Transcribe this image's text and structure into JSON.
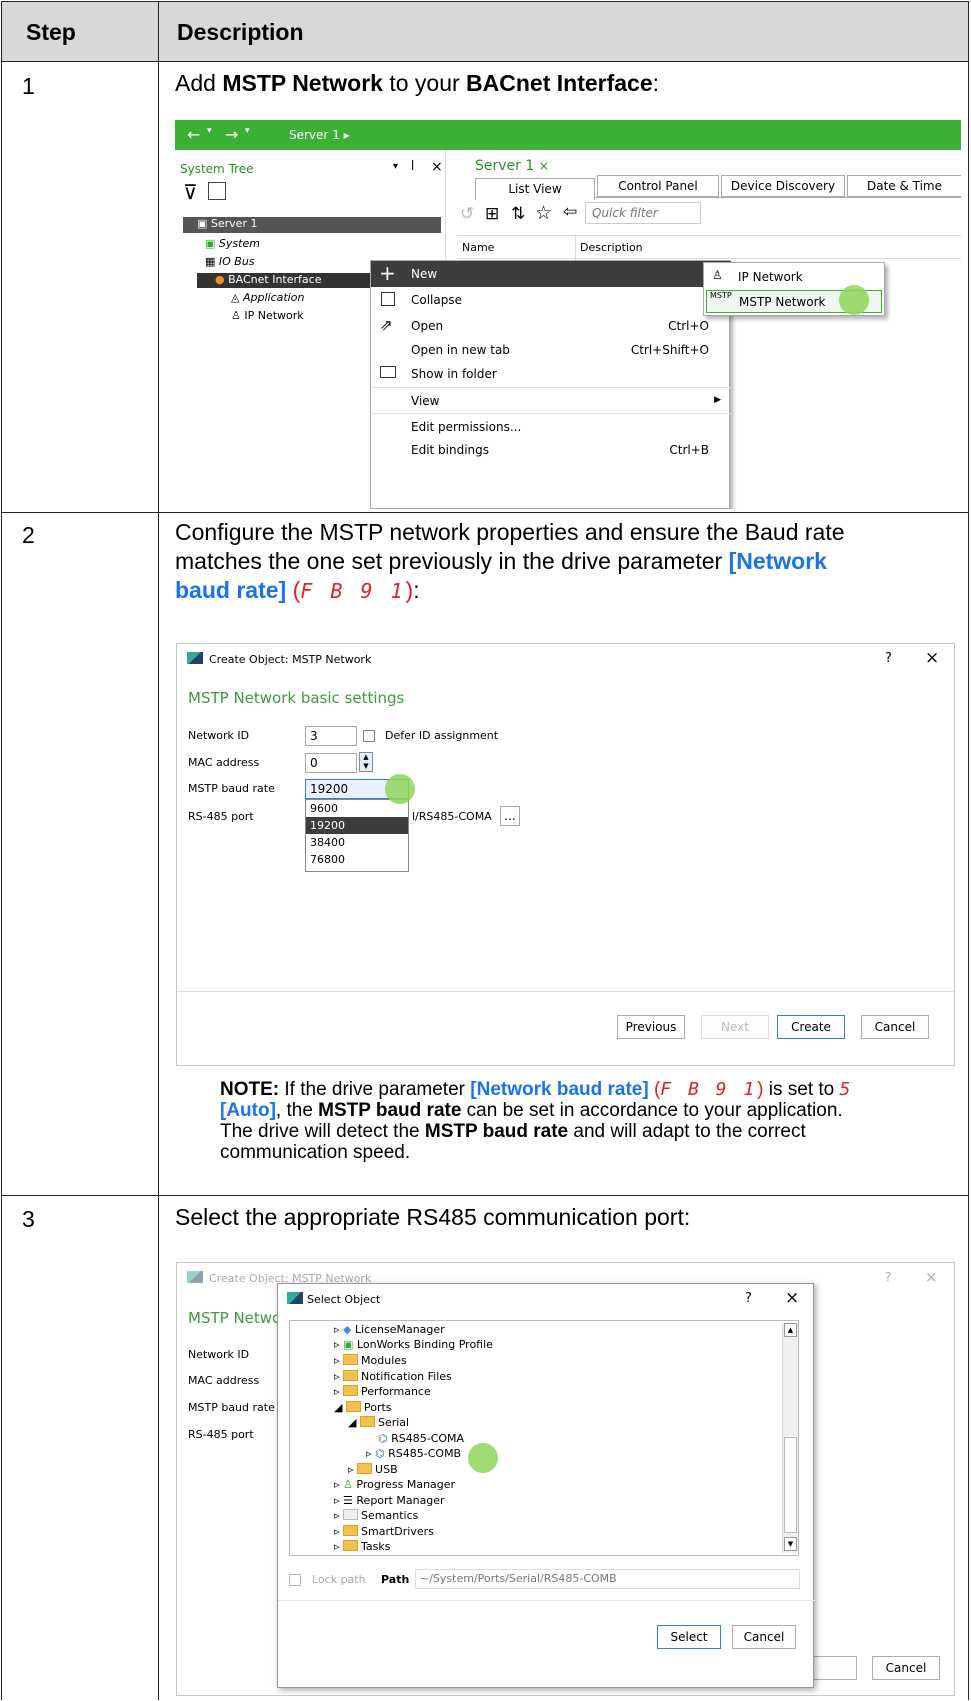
{
  "table": {
    "header": {
      "step": "Step",
      "description": "Description"
    },
    "rows": [
      {
        "step": "1",
        "text_parts": [
          "Add ",
          "MSTP Network",
          " to your ",
          "BACnet Interface",
          ":"
        ]
      },
      {
        "step": "2",
        "text_line1": "Configure the MSTP network properties and ensure the Baud rate",
        "text_line2": "matches the one set previously in the drive parameter ",
        "param": "[Network",
        "param2": "baud rate]",
        "code": "F B 9 1",
        "suffix": ":"
      },
      {
        "step": "3",
        "text": "Select the appropriate RS485 communication port:"
      }
    ]
  },
  "shot1": {
    "toolbar": {
      "crumb": "Server 1 ▸"
    },
    "system_tree": {
      "title": "System Tree",
      "items": [
        {
          "label": "Server 1",
          "selected": true
        },
        {
          "label": "System"
        },
        {
          "label": "IO Bus"
        },
        {
          "label": "BACnet Interface",
          "highlight": true
        },
        {
          "label": "Application"
        },
        {
          "label": "IP Network"
        }
      ]
    },
    "tab_title": "Server 1",
    "tab_close": "×",
    "tabs": [
      "List View",
      "Control Panel",
      "Device Discovery",
      "Date & Time"
    ],
    "quick_filter": "Quick filter",
    "columns": [
      "Name",
      "Description"
    ],
    "context_menu": [
      {
        "label": "New",
        "shortcut": ""
      },
      {
        "label": "Collapse",
        "shortcut": ""
      },
      {
        "label": "Open",
        "shortcut": "Ctrl+O"
      },
      {
        "label": "Open in new tab",
        "shortcut": "Ctrl+Shift+O"
      },
      {
        "label": "Show in folder",
        "shortcut": ""
      },
      {
        "label": "View",
        "shortcut": ""
      },
      {
        "label": "Edit permissions...",
        "shortcut": ""
      },
      {
        "label": "Edit bindings",
        "shortcut": "Ctrl+B"
      }
    ],
    "submenu": [
      "IP Network",
      "MSTP Network"
    ]
  },
  "shot2": {
    "title": "Create Object: MSTP Network",
    "help": "?",
    "close": "×",
    "section": "MSTP Network basic settings",
    "fields": {
      "network_id_label": "Network ID",
      "network_id": "3",
      "defer_label": "Defer ID assignment",
      "mac_label": "MAC address",
      "mac": "0",
      "baud_label": "MSTP baud rate",
      "baud": "19200",
      "port_label": "RS-485 port",
      "port": "l/RS485-COMA",
      "browse": "..."
    },
    "baud_options": [
      "9600",
      "19200",
      "38400",
      "76800"
    ],
    "buttons": {
      "previous": "Previous",
      "next": "Next",
      "create": "Create",
      "cancel": "Cancel"
    }
  },
  "note": {
    "bold": "NOTE:",
    "t1": " If the drive parameter ",
    "param": "[Network baud rate]",
    "code": "F B 9 1",
    "t2": " is set to ",
    "code2": "5",
    "auto": "[Auto]",
    "t3": ", the ",
    "b1": "MSTP baud rate",
    "t4": " can be set in accordance to your application.",
    "t5": "The drive will detect the ",
    "b2": "MSTP baud rate",
    "t6": " and will adapt to the correct",
    "t7": "communication speed."
  },
  "shot3": {
    "bg_title": "Create Object: MSTP Network",
    "bg_labels": [
      "MSTP Netwo",
      "Network ID",
      "MAC address",
      "MSTP baud rate",
      "RS-485 port"
    ],
    "title": "Select Object",
    "help": "?",
    "close": "×",
    "tree": [
      "LicenseManager",
      "LonWorks Binding Profile",
      "Modules",
      "Notification Files",
      "Performance",
      "Ports",
      "Serial",
      "RS485-COMA",
      "RS485-COMB",
      "USB",
      "Progress Manager",
      "Report Manager",
      "Semantics",
      "SmartDrivers",
      "Tasks"
    ],
    "lock_path": "Lock path",
    "path_label": "Path",
    "path": "~/System/Ports/Serial/RS485-COMB",
    "select": "Select",
    "cancel": "Cancel",
    "bg_cancel": "Cancel"
  }
}
